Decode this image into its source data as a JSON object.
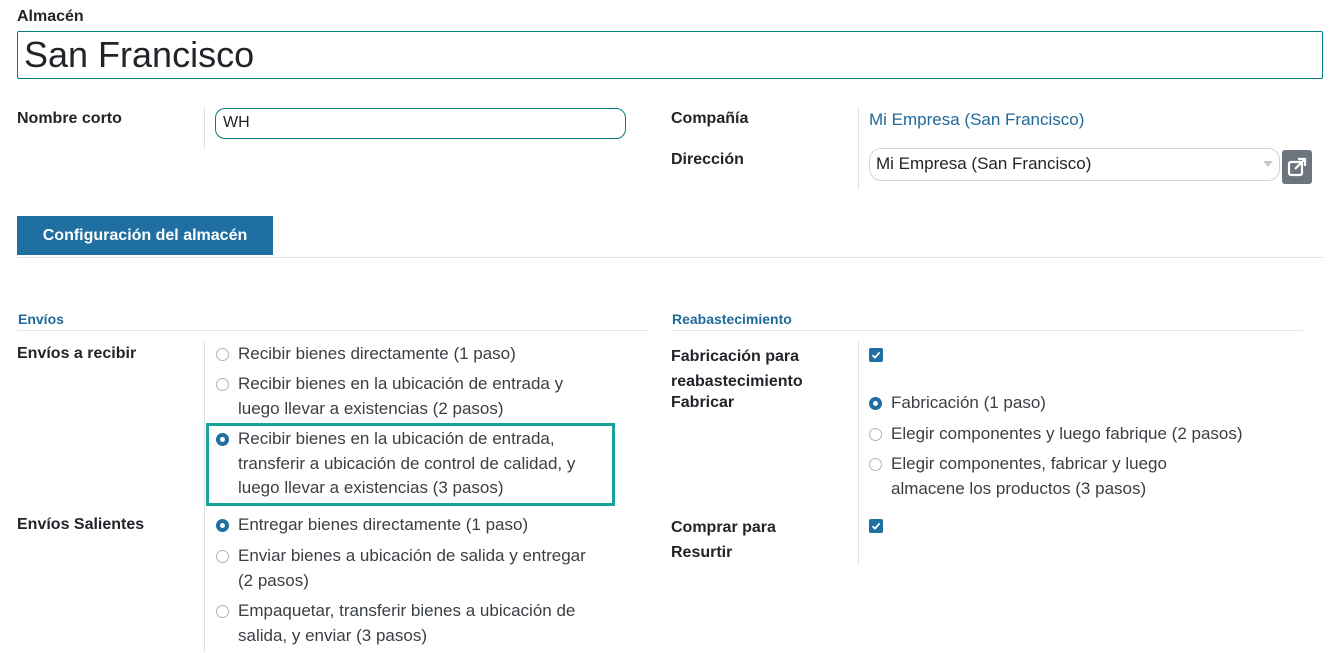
{
  "warehouse": {
    "label": "Almacén",
    "name": "San Francisco"
  },
  "fields": {
    "short_name_label": "Nombre corto",
    "short_name_value": "WH",
    "company_label": "Compañía",
    "company_value": "Mi Empresa (San Francisco)",
    "address_label": "Dirección",
    "address_value": "Mi Empresa (San Francisco)"
  },
  "tabs": [
    {
      "label": "Configuración del almacén",
      "active": true
    }
  ],
  "shipments": {
    "section_title": "Envíos",
    "incoming_label": "Envíos a recibir",
    "incoming_options": [
      {
        "lines": [
          "Recibir bienes directamente (1 paso)"
        ],
        "selected": false
      },
      {
        "lines": [
          "Recibir bienes en la ubicación de entrada y",
          "luego llevar a existencias (2 pasos)"
        ],
        "selected": false
      },
      {
        "lines": [
          "Recibir bienes en la ubicación de entrada,",
          "transferir a ubicación de control de calidad, y",
          "luego llevar a existencias (3 pasos)"
        ],
        "selected": true
      }
    ],
    "outgoing_label": "Envíos Salientes",
    "outgoing_options": [
      {
        "lines": [
          "Entregar bienes directamente (1 paso)"
        ],
        "selected": true
      },
      {
        "lines": [
          "Enviar bienes a ubicación de salida y entregar",
          "(2 pasos)"
        ],
        "selected": false
      },
      {
        "lines": [
          "Empaquetar, transferir bienes a ubicación de",
          "salida, y enviar (3 pasos)"
        ],
        "selected": false
      }
    ]
  },
  "resupply": {
    "section_title": "Reabastecimiento",
    "manufacture_resupply_label_lines": [
      "Fabricación para",
      "reabastecimiento"
    ],
    "manufacture_resupply_checked": true,
    "manufacture_label": "Fabricar",
    "manufacture_options": [
      {
        "lines": [
          "Fabricación (1 paso)"
        ],
        "selected": true
      },
      {
        "lines": [
          "Elegir componentes y luego fabrique (2 pasos)"
        ],
        "selected": false
      },
      {
        "lines": [
          "Elegir componentes, fabricar y luego",
          "almacene los productos (3 pasos)"
        ],
        "selected": false
      }
    ],
    "buy_label_lines": [
      "Comprar para",
      "Resurtir"
    ],
    "buy_checked": true
  },
  "colors": {
    "accent": "#1f6fa3",
    "link": "#1f6a99",
    "highlight": "#16a39a"
  },
  "icons": {
    "external_link": "external-link-icon",
    "dropdown": "caret-down-icon",
    "checkbox": "check-icon"
  }
}
